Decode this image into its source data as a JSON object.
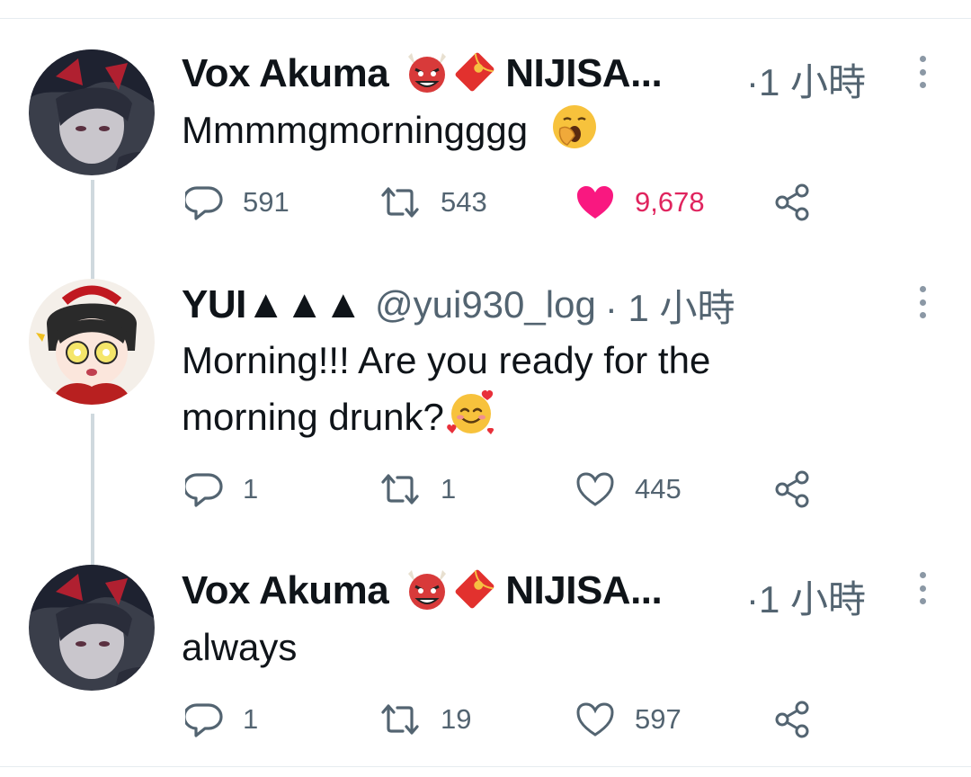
{
  "tweets": [
    {
      "author": "Vox Akuma",
      "author_suffix": "NIJISA...",
      "time": "·1 小時",
      "text": "Mmmmgmorningggg",
      "text_emoji": "yawning-face",
      "stats": {
        "replies": "591",
        "retweets": "543",
        "likes": "9,678"
      },
      "liked": true
    },
    {
      "author": "YUI▲▲▲",
      "handle": "@yui930_log",
      "time": "· 1 小時",
      "text_line1": "Morning!!! Are you ready for the",
      "text_line2": "morning drunk?",
      "text_emoji": "smiling-face-with-hearts",
      "stats": {
        "replies": "1",
        "retweets": "1",
        "likes": "445"
      },
      "liked": false
    },
    {
      "author": "Vox Akuma",
      "author_suffix": "NIJISA...",
      "time": "·1 小時",
      "text": "always",
      "stats": {
        "replies": "1",
        "retweets": "19",
        "likes": "597"
      },
      "liked": false
    }
  ],
  "colors": {
    "like_active": "#f91880",
    "like_count_active": "#e0245e",
    "secondary_text": "#536471",
    "thread_line": "#cfd9de"
  }
}
